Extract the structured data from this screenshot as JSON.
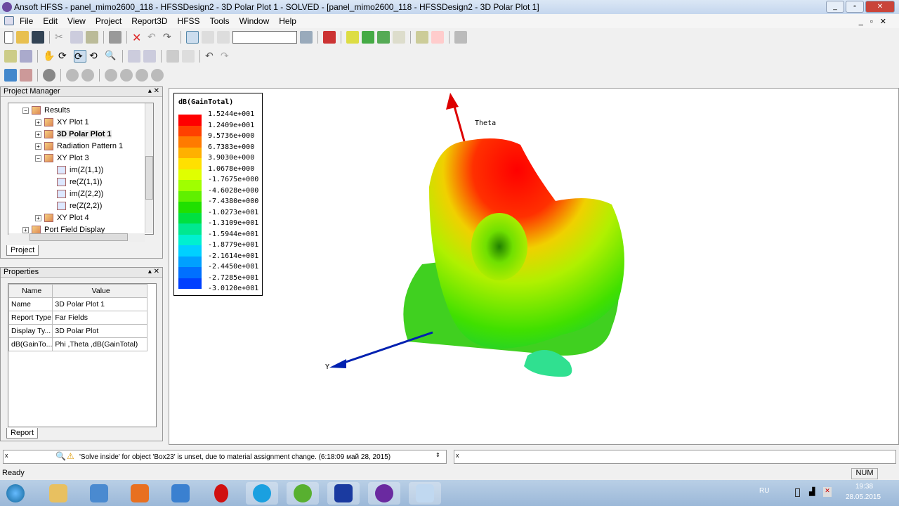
{
  "window": {
    "title": "Ansoft HFSS - panel_mimo2600_118 - HFSSDesign2 - 3D Polar Plot 1 - SOLVED - [panel_mimo2600_118 - HFSSDesign2 - 3D Polar Plot 1]",
    "controls": [
      "_",
      "▫",
      "✕"
    ]
  },
  "menu": [
    "File",
    "Edit",
    "View",
    "Project",
    "Report3D",
    "HFSS",
    "Tools",
    "Window",
    "Help"
  ],
  "mdi_controls": [
    "_",
    "▫",
    "✕"
  ],
  "project_manager": {
    "title": "Project Manager",
    "tab": "Project",
    "tree": [
      {
        "label": "Results",
        "level": 1,
        "exp": "−"
      },
      {
        "label": "XY Plot 1",
        "level": 2,
        "exp": "+"
      },
      {
        "label": "3D Polar Plot 1",
        "level": 2,
        "exp": "+",
        "bold": true
      },
      {
        "label": "Radiation Pattern 1",
        "level": 2,
        "exp": "+"
      },
      {
        "label": "XY Plot 3",
        "level": 2,
        "exp": "−"
      },
      {
        "label": "im(Z(1,1))",
        "level": 3
      },
      {
        "label": "re(Z(1,1))",
        "level": 3
      },
      {
        "label": "im(Z(2,2))",
        "level": 3
      },
      {
        "label": "re(Z(2,2))",
        "level": 3
      },
      {
        "label": "XY Plot 4",
        "level": 2,
        "exp": "+"
      },
      {
        "label": "Port Field Display",
        "level": 1,
        "exp": "+"
      }
    ]
  },
  "properties": {
    "title": "Properties",
    "tab": "Report",
    "headers": [
      "Name",
      "Value"
    ],
    "rows": [
      [
        "Name",
        "3D Polar Plot 1"
      ],
      [
        "Report Type",
        "Far Fields"
      ],
      [
        "Display Ty...",
        "3D Polar Plot"
      ],
      [
        "dB(GainTo...",
        "Phi ,Theta ,dB(GainTotal)"
      ]
    ]
  },
  "plot": {
    "legend_title": "dB(GainTotal)",
    "legend_values": [
      "1.5244e+001",
      "1.2409e+001",
      "9.5736e+000",
      "6.7383e+000",
      "3.9030e+000",
      "1.0678e+000",
      "-1.7675e+000",
      "-4.6028e+000",
      "-7.4380e+000",
      "-1.0273e+001",
      "-1.3109e+001",
      "-1.5944e+001",
      "-1.8779e+001",
      "-2.1614e+001",
      "-2.4450e+001",
      "-2.7285e+001",
      "-3.0120e+001"
    ],
    "legend_colors": [
      "#ff0000",
      "#ff4000",
      "#ff7a00",
      "#ffb000",
      "#ffe000",
      "#e0ff00",
      "#a0ff00",
      "#60f000",
      "#20e000",
      "#00e040",
      "#00e890",
      "#00f0d0",
      "#00d0ff",
      "#00a0ff",
      "#0070ff",
      "#0040ff"
    ],
    "axis_theta": "Theta",
    "axis_y": "Y"
  },
  "message": "'Solve inside' for object 'Box23' is unset, due to material assignment change. (6:18:09 май 28, 2015)",
  "status": {
    "text": "Ready",
    "num": "NUM"
  },
  "tray": {
    "lang": "RU",
    "time": "19:38",
    "date": "28.05.2015"
  }
}
